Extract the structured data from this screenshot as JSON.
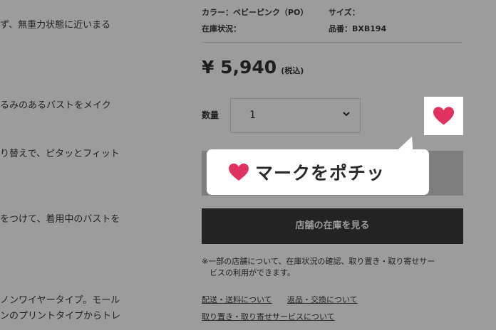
{
  "description_lines": [
    "ず、無重力状態に近いまる",
    "るみのあるバストをメイク",
    "り替えで、ピタッとフィット",
    "をつけて、着用中のバストを",
    "ノンワイヤータイプ。モール",
    "ンのプリントタイプからトレ"
  ],
  "product": {
    "color": "カラー：ベビーピンク（PO）",
    "size": "サイズ：",
    "stock": "在庫状況：",
    "product_no": "品番：BXB194",
    "price": "¥ 5,940",
    "tax": "(税込)"
  },
  "quantity": {
    "label": "数量",
    "value": "1"
  },
  "buttons": {
    "store_stock": "店舗の在庫を見る"
  },
  "note": {
    "line1": "※一部の店舗について、在庫状況の確認、取り置き・取り寄せサー",
    "line2": "ビスの利用ができます。"
  },
  "links": {
    "shipping": "配送・送料について",
    "returns": "返品・交換について",
    "reserve": "取り置き・取り寄せサービスについて"
  },
  "callout": {
    "text": "マークをポチッ"
  },
  "colors": {
    "heart": "#e0325f",
    "overlay": "#9c9c9c",
    "button_dark": "#232323"
  }
}
